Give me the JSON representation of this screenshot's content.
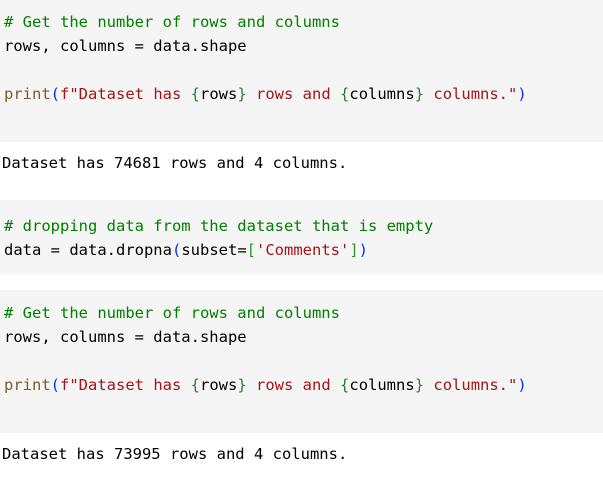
{
  "cells": [
    {
      "comment": "# Get the number of rows and columns",
      "line2": "rows, columns = data.shape",
      "print_fn": "print",
      "print_open": "(",
      "fstring_prefix": "f\"Dataset has ",
      "brace_open_1": "{",
      "var_rows": "rows",
      "brace_close_1": "}",
      "fstring_mid": " rows and ",
      "brace_open_2": "{",
      "var_columns": "columns",
      "brace_close_2": "}",
      "fstring_suffix": " columns.\"",
      "print_close": ")"
    },
    {
      "comment": "# dropping data from the dataset that is empty",
      "assign_lhs": "data = data.dropna",
      "paren_open": "(",
      "kwarg": "subset=",
      "bracket_open": "[",
      "string_arg": "'Comments'",
      "bracket_close": "]",
      "paren_close": ")"
    },
    {
      "comment": "# Get the number of rows and columns",
      "line2": "rows, columns = data.shape",
      "print_fn": "print",
      "print_open": "(",
      "fstring_prefix": "f\"Dataset has ",
      "brace_open_1": "{",
      "var_rows": "rows",
      "brace_close_1": "}",
      "fstring_mid": " rows and ",
      "brace_open_2": "{",
      "var_columns": "columns",
      "brace_close_2": "}",
      "fstring_suffix": " columns.\"",
      "print_close": ")"
    }
  ],
  "outputs": [
    "Dataset has 74681 rows and 4 columns.",
    "Dataset has 73995 rows and 4 columns."
  ],
  "colors": {
    "comment": "#008000",
    "builtin": "#795e26",
    "string": "#a31515",
    "cell_background": "#f5f5f5"
  }
}
